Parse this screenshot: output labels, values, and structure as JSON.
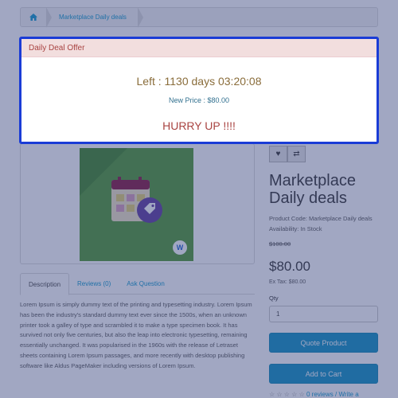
{
  "breadcrumb": {
    "home_icon": "home-icon",
    "current": "Marketplace Daily deals"
  },
  "product": {
    "title": "Marketplace Daily deals",
    "code_line": "Product Code: Marketplace Daily deals",
    "availability_line": "Availability: In Stock",
    "old_price": "$100.00",
    "price": "$80.00",
    "ex_tax": "Ex Tax: $80.00",
    "qty_label": "Qty",
    "qty_value": "1",
    "quote_button": "Quote Product",
    "cart_button": "Add to Cart",
    "stars": "☆ ☆ ☆ ☆ ☆",
    "reviews_link": "0 reviews",
    "separator": "/",
    "write_link": "Write a",
    "brand_badge": "W"
  },
  "tabs": [
    {
      "label": "Description"
    },
    {
      "label": "Reviews (0)"
    },
    {
      "label": "Ask Question"
    }
  ],
  "description": "Lorem Ipsum is simply dummy text of the printing and typesetting industry. Lorem Ipsum has been the industry's standard dummy text ever since the 1500s, when an unknown printer took a galley of type and scrambled it to make a type specimen book. It has survived not only five centuries, but also the leap into electronic typesetting, remaining essentially unchanged. It was popularised in the 1960s with the release of Letraset sheets containing Lorem Ipsum passages, and more recently with desktop publishing software like Aldus PageMaker including versions of Lorem Ipsum.",
  "modal": {
    "header": "Daily Deal Offer",
    "timer": "Left : 1130 days 03:20:08",
    "new_price": "New Price : $80.00",
    "hurry": "HURRY UP !!!!"
  },
  "colors": {
    "accent_blue": "#229ac8",
    "modal_border": "#1a3cd6",
    "alert_bg": "#f2dede",
    "alert_text": "#a94442"
  }
}
